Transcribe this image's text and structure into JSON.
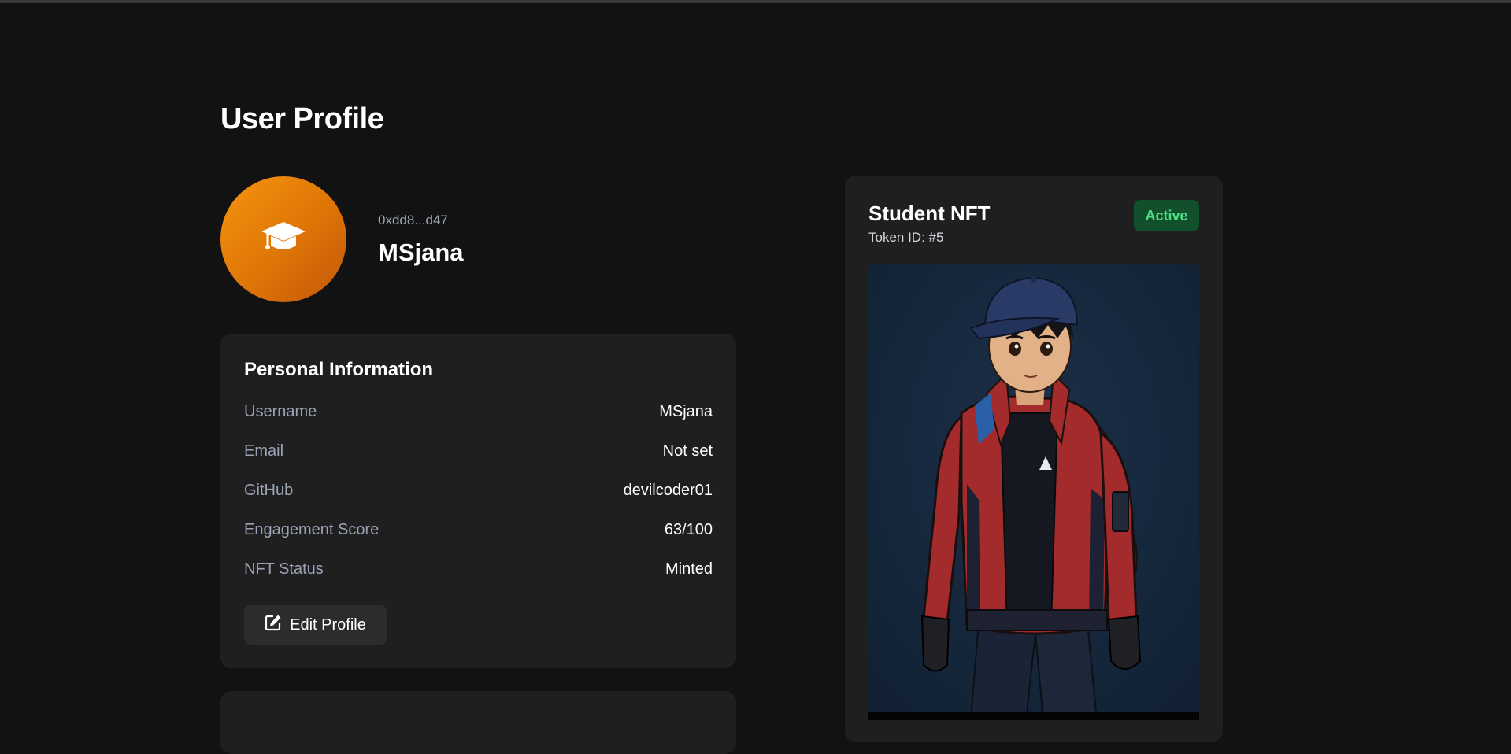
{
  "page": {
    "title": "User Profile"
  },
  "profile": {
    "wallet_address": "0xdd8...d47",
    "display_name": "MSjana",
    "avatar_icon": "graduation-cap-icon",
    "avatar_gradient": [
      "#f59410",
      "#c4560a"
    ]
  },
  "personal_info": {
    "title": "Personal Information",
    "rows": [
      {
        "label": "Username",
        "value": "MSjana"
      },
      {
        "label": "Email",
        "value": "Not set"
      },
      {
        "label": "GitHub",
        "value": "devilcoder01"
      },
      {
        "label": "Engagement Score",
        "value": "63/100"
      },
      {
        "label": "NFT Status",
        "value": "Minted"
      }
    ],
    "edit_button": {
      "label": "Edit Profile",
      "icon": "edit-icon"
    }
  },
  "nft": {
    "title": "Student NFT",
    "token_id": "Token ID: #5",
    "status": "Active",
    "status_colors": {
      "background": "#12502b",
      "text": "#4be083"
    },
    "image": "anime-student-character-illustration"
  },
  "colors": {
    "background": "#131213",
    "card": "#1f1f20",
    "label": "#9aa3b5",
    "text": "#ffffff"
  }
}
